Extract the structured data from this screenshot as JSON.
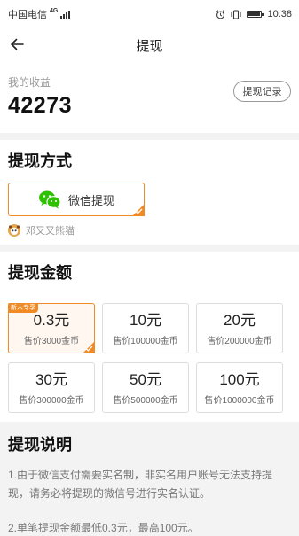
{
  "status_bar": {
    "carrier": "中国电信",
    "network": "4G",
    "time": "10:38"
  },
  "nav": {
    "title": "提现",
    "back_icon": "back-arrow-icon"
  },
  "earnings": {
    "label": "我的收益",
    "amount": "42273",
    "record_button": "提现记录"
  },
  "method_section": {
    "title": "提现方式",
    "method_label": "微信提现",
    "method_icon": "wechat-icon",
    "account_name": "邓又又熊猫"
  },
  "amount_section": {
    "title": "提现金额",
    "badge": "新人专享",
    "options": [
      {
        "value": "0.3元",
        "price": "售价3000金币",
        "selected": true
      },
      {
        "value": "10元",
        "price": "售价100000金币",
        "selected": false
      },
      {
        "value": "20元",
        "price": "售价200000金币",
        "selected": false
      },
      {
        "value": "30元",
        "price": "售价300000金币",
        "selected": false
      },
      {
        "value": "50元",
        "price": "售价500000金币",
        "selected": false
      },
      {
        "value": "100元",
        "price": "售价1000000金币",
        "selected": false
      }
    ]
  },
  "explain_section": {
    "title": "提现说明",
    "items": [
      "1.由于微信支付需要实名制，非实名用户账号无法支持提现，请务必将提现的微信号进行实名认证。",
      "2.单笔提现金额最低0.3元，最高100元。"
    ]
  },
  "colors": {
    "accent": "#f08a24",
    "wechat_green": "#2dc100",
    "section_bg": "#f3f3f3"
  }
}
